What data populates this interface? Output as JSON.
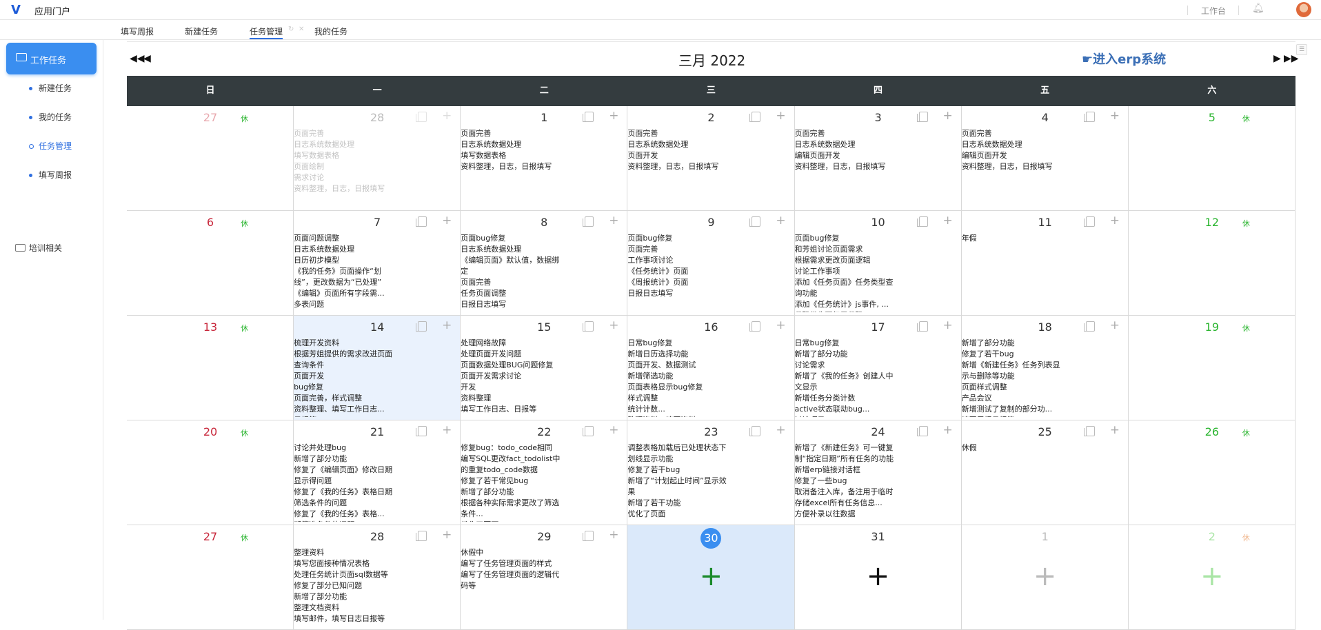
{
  "app": {
    "title": "应用门户",
    "workbench": "工作台"
  },
  "tabs": [
    {
      "label": "填写周报"
    },
    {
      "label": "新建任务"
    },
    {
      "label": "任务管理"
    },
    {
      "label": "我的任务"
    }
  ],
  "sidebar": {
    "active": "工作任务",
    "items": [
      {
        "label": "新建任务"
      },
      {
        "label": "我的任务"
      },
      {
        "label": "任务管理"
      },
      {
        "label": "填写周报"
      }
    ],
    "group": "培训相关"
  },
  "calendar": {
    "month_title": "三月 2022",
    "erp_link": "☛进入erp系统",
    "weekdays": [
      "日",
      "一",
      "二",
      "三",
      "四",
      "五",
      "六"
    ],
    "rest_label": "休",
    "weeks": [
      [
        {
          "day": "27",
          "style": "faded-red",
          "rest": true
        },
        {
          "day": "28",
          "style": "faded",
          "tasks": [
            "页面完善",
            "日志系统数据处理",
            "填写数据表格",
            "页面绘制",
            "需求讨论",
            "资料整理，日志，日报填写"
          ]
        },
        {
          "day": "1",
          "tasks": [
            "页面完善",
            "日志系统数据处理",
            "填写数据表格",
            "资料整理，日志，日报填写"
          ]
        },
        {
          "day": "2",
          "tasks": [
            "页面完善",
            "日志系统数据处理",
            "页面开发",
            "资料整理，日志，日报填写"
          ]
        },
        {
          "day": "3",
          "tasks": [
            "页面完善",
            "日志系统数据处理",
            "编辑页面开发",
            "资料整理，日志，日报填写"
          ]
        },
        {
          "day": "4",
          "tasks": [
            "页面完善",
            "日志系统数据处理",
            "编辑页面开发",
            "资料整理，日志，日报填写"
          ]
        },
        {
          "day": "5",
          "style": "green",
          "rest": true
        }
      ],
      [
        {
          "day": "6",
          "style": "red",
          "rest": true
        },
        {
          "day": "7",
          "tasks": [
            "页面问题调整",
            "日志系统数据处理",
            "日历初步模型",
            "《我的任务》页面操作“划线”，更改数据为“已处理”",
            "《编辑》页面所有字段需...",
            "多表问题"
          ]
        },
        {
          "day": "8",
          "tasks": [
            "页面bug修复",
            "日志系统数据处理",
            "《编辑页面》默认值，数据绑定",
            "页面完善",
            "任务页面调整",
            "日报日志填写"
          ]
        },
        {
          "day": "9",
          "tasks": [
            "页面bug修复",
            "页面完善",
            "工作事项讨论",
            "《任务统计》页面",
            "《周报统计》页面",
            "日报日志填写"
          ]
        },
        {
          "day": "10",
          "tasks": [
            "页面bug修复",
            "和芳姐讨论页面需求",
            "根据需求更改页面逻辑",
            "讨论工作事项",
            "添加《任务页面》任务类型查询功能",
            "添加《任务统计》js事件, ...",
            "代码优化可复用代码"
          ]
        },
        {
          "day": "11",
          "tasks": [
            "年假"
          ]
        },
        {
          "day": "12",
          "style": "green",
          "rest": true
        }
      ],
      [
        {
          "day": "13",
          "style": "red",
          "rest": true
        },
        {
          "day": "14",
          "highlight": true,
          "tasks": [
            "梳理开发资料",
            "根据芳姐提供的需求改进页面查询条件",
            "页面开发",
            "bug修复",
            "页面完善，样式调整",
            "资料整理、填写工作日志...",
            "日报等"
          ]
        },
        {
          "day": "15",
          "tasks": [
            "处理网络故障",
            "处理页面开发问题",
            "页面数据处理BUG问题修复",
            "页面开发需求讨论",
            "开发",
            "资料整理",
            "填写工作日志、日报等"
          ]
        },
        {
          "day": "16",
          "tasks": [
            "日常bug修复",
            "新增日历选择功能",
            "页面开发、数据测试",
            "新增筛选功能",
            "页面表格显示bug修复",
            "样式调整",
            "统计计数...",
            "整理资料、填写资料"
          ]
        },
        {
          "day": "17",
          "tasks": [
            "日常bug修复",
            "新增了部分功能",
            "讨论需求",
            "新增了《我的任务》创建人中文显示",
            "新增任务分类计数",
            "active状态联动bug...",
            "讨论项目"
          ]
        },
        {
          "day": "18",
          "tasks": [
            "新增了部分功能",
            "修复了若干bug",
            "新增《新建任务》任务列表显示与删除等功能",
            "页面样式调整",
            "产品会议",
            "新增测试了复制的部分功...",
            "填写周报日报等"
          ]
        },
        {
          "day": "19",
          "style": "green",
          "rest": true
        }
      ],
      [
        {
          "day": "20",
          "style": "red",
          "rest": true
        },
        {
          "day": "21",
          "tasks": [
            "讨论并处理bug",
            "新增了部分功能",
            "修复了《编辑页面》修改日期显示得问题",
            "修复了《我的任务》表格日期筛选条件的问题",
            "修复了《我的任务》表格...",
            "期筛选条件的问题"
          ]
        },
        {
          "day": "22",
          "tasks": [
            "修复bug：todo_code相同",
            "编写SQL更改fact_todolist中的重复todo_code数据",
            "修复了若干常见bug",
            "新增了部分功能",
            "根据各种实际需求更改了筛选条件...",
            "优化了页面"
          ]
        },
        {
          "day": "23",
          "tasks": [
            "调整表格加载后已处理状态下划线显示功能",
            "修复了若干bug",
            "新增了“计划起止时间”显示效果",
            "新增了若干功能",
            "优化了页面"
          ]
        },
        {
          "day": "24",
          "tasks": [
            "新增了《新建任务》可一键复制“指定日期”所有任务的功能",
            "新增erp链接对话框",
            "修复了一些bug",
            "取消备注入库，备注用于临时存储excel所有任务信息...",
            "方便补录以往数据"
          ]
        },
        {
          "day": "25",
          "tasks": [
            "休假"
          ]
        },
        {
          "day": "26",
          "style": "green",
          "rest": true
        }
      ],
      [
        {
          "day": "27",
          "style": "red",
          "rest": true
        },
        {
          "day": "28",
          "tasks": [
            "整理资料",
            "填写您面接种情况表格",
            "处理任务统计页面sql数据等",
            "修复了部分已知问题",
            "新增了部分功能",
            "整理文档资料",
            "填写邮件，填写日志日报等"
          ]
        },
        {
          "day": "29",
          "tasks": [
            "休假中",
            "编写了任务管理页面的样式",
            "编写了任务管理页面的逻辑代码等"
          ]
        },
        {
          "day": "30",
          "today": true,
          "plus_color": "#1a8a2a"
        },
        {
          "day": "31",
          "plus_color": "#111111"
        },
        {
          "day": "1",
          "style": "faded",
          "plus_color": "#bbbbbb"
        },
        {
          "day": "2",
          "style": "faded-green",
          "rest": true,
          "rest_faded": true,
          "plus_color": "#a9e5a5"
        }
      ]
    ]
  },
  "colors": {
    "accent": "#3a8ef0",
    "header_bg": "#343c3f",
    "weekend_red": "#c8273b",
    "weekend_green": "#2bb530"
  },
  "icons": [
    "logo-icon",
    "bell-icon",
    "avatar",
    "folder-icon",
    "doc-icon",
    "plus-icon",
    "prev-year-icon",
    "prev-month-icon",
    "next-month-icon",
    "next-year-icon"
  ]
}
